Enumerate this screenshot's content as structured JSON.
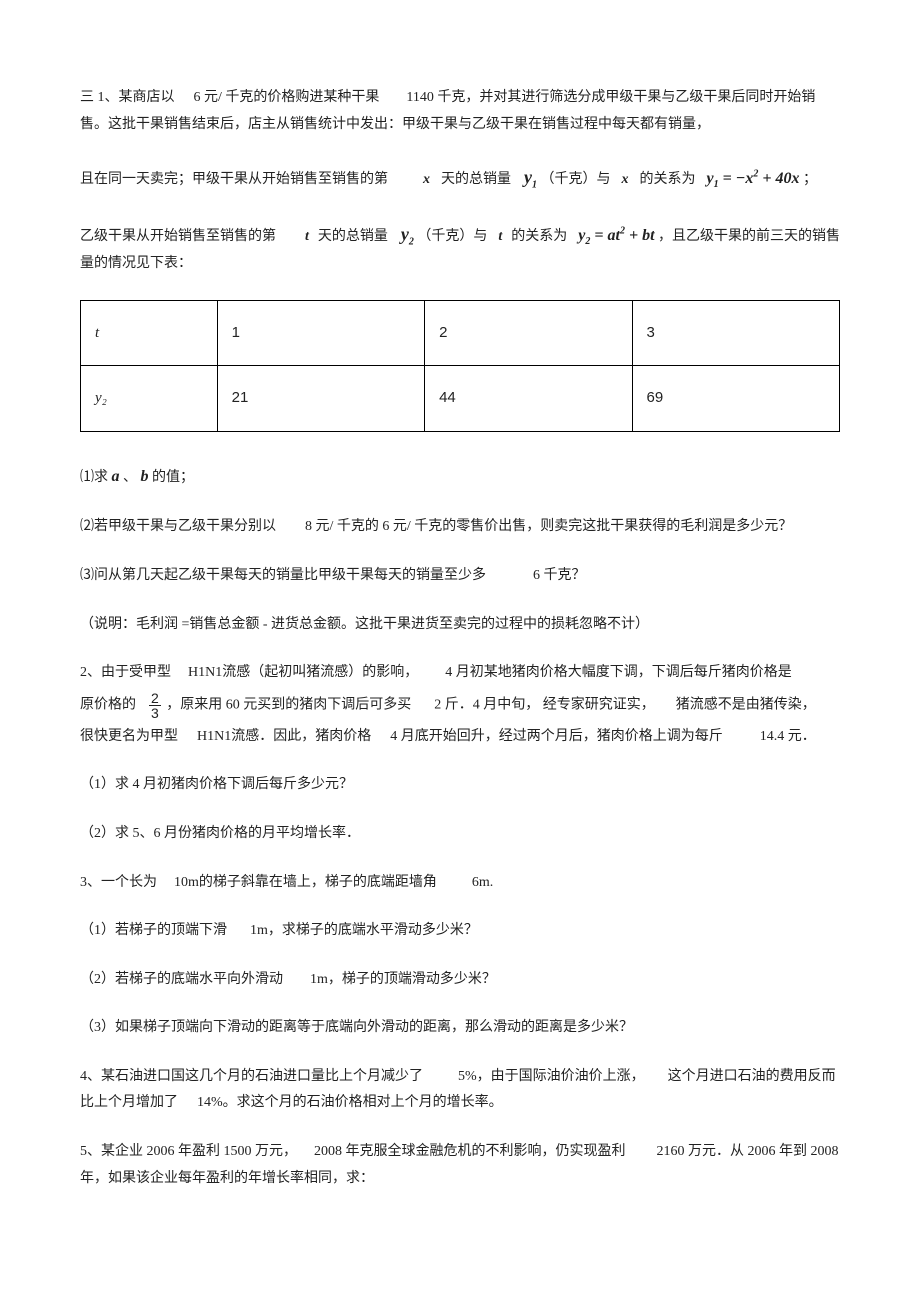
{
  "p1a": "三 1、某商店以",
  "p1b": "6 元/ 千克的价格购进某种干果",
  "p1c": "1140 千克，并对其进行筛选分成甲级干果与乙级干果后同时开始销售。这批干果销售结束后，店主从销售统计中发出：甲级干果与乙级干果在销售过程中每天都有销量，",
  "p2a": "且在同一天卖完；甲级干果从开始销售至销售的第",
  "p2b": "天的总销量",
  "p2c": "（千克）与",
  "p2d": "的关系为",
  "eq1_lhs": "y",
  "eq1_sub": "1",
  "eq1_rhs": " = −x",
  "eq1_sup": "2",
  "eq1_tail": " + 40x",
  "p2e": " ；",
  "p3a": "乙级干果从开始销售至销售的第",
  "p3b": "天的总销量",
  "p3c": "（千克）与",
  "p3d": "的关系为",
  "eq2_lhs": "y",
  "eq2_sub": "2",
  "eq2_rhs": " = at",
  "eq2_sup": "2",
  "eq2_tail": " + bt",
  "p3e": "，且乙级干果的前三天的销售量的情况见下表：",
  "tbl": {
    "r1c1": "t",
    "r1c2": "1",
    "r1c3": "2",
    "r1c4": "3",
    "r2c1": "y₂",
    "r2c2": "21",
    "r2c3": "44",
    "r2c4": "69"
  },
  "q1a": "⑴求",
  "q1sym1": "a",
  "q1mid": "、",
  "q1sym2": "b",
  "q1b": " 的值；",
  "q2a": "⑵若甲级干果与乙级干果分别以",
  "q2b": "8 元/ 千克的  6 元/ 千克的零售价出售，则卖完这批干果获得的毛利润是多少元？",
  "q3a": "⑶问从第几天起乙级干果每天的销量比甲级干果每天的销量至少多",
  "q3b": "6 千克？",
  "note": "（说明：毛利润  =销售总金额  - 进货总金额。这批干果进货至卖完的过程中的损耗忽略不计）",
  "p2_1a": "2、由于受甲型",
  "p2_1b": "H1N1流感（起初叫猪流感）的影响，",
  "p2_1c": "4 月初某地猪肉价格大幅度下调，下调后每斤猪肉价格是",
  "p2_2a": "原价格的",
  "frac_num": "2",
  "frac_den": "3",
  "p2_2b": "，原来用  60 元买到的猪肉下调后可多买",
  "p2_2c": "2 斤．4 月中旬，  经专家研究证实，",
  "p2_2d": "猪流感不是由猪传染，",
  "p2_3a": "很快更名为甲型",
  "p2_3b": "H1N1流感．因此，猪肉价格",
  "p2_3c": "4 月底开始回升，经过两个月后，猪肉价格上调为每斤",
  "p2_3d": "14.4  元．",
  "p2_q1": "（1）求 4 月初猪肉价格下调后每斤多少元？",
  "p2_q2": "（2）求 5、6 月份猪肉价格的月平均增长率．",
  "p3_1a": "3、一个长为",
  "p3_1b": "10m的梯子斜靠在墙上，梯子的底端距墙角",
  "p3_1c": "6m.",
  "p3_q1a": "（1）若梯子的顶端下滑",
  "p3_q1b": "1m，求梯子的底端水平滑动多少米？",
  "p3_q2a": "（2）若梯子的底端水平向外滑动",
  "p3_q2b": "1m，梯子的顶端滑动多少米？",
  "p3_q3": "（3）如果梯子顶端向下滑动的距离等于底端向外滑动的距离，那么滑动的距离是多少米？",
  "p4_1a": "4、某石油进口国这几个月的石油进口量比上个月减少了",
  "p4_1b": "5%，由于国际油价油价上涨，",
  "p4_1c": "这个月进口石油的费用反而比上个月增加了",
  "p4_1d": "14%。求这个月的石油价格相对上个月的增长率。",
  "p5_1a": "5、某企业  2006 年盈利  1500 万元，",
  "p5_1b": "2008 年克服全球金融危机的不利影响，仍实现盈利",
  "p5_1c": "2160 万元．从  2006 年到  2008 年，如果该企业每年盈利的年增长率相同，求：",
  "sym_x": "x",
  "sym_t": "t",
  "sym_y1": "y",
  "sym_y1sub": "1",
  "sym_y2": "y",
  "sym_y2sub": "2"
}
